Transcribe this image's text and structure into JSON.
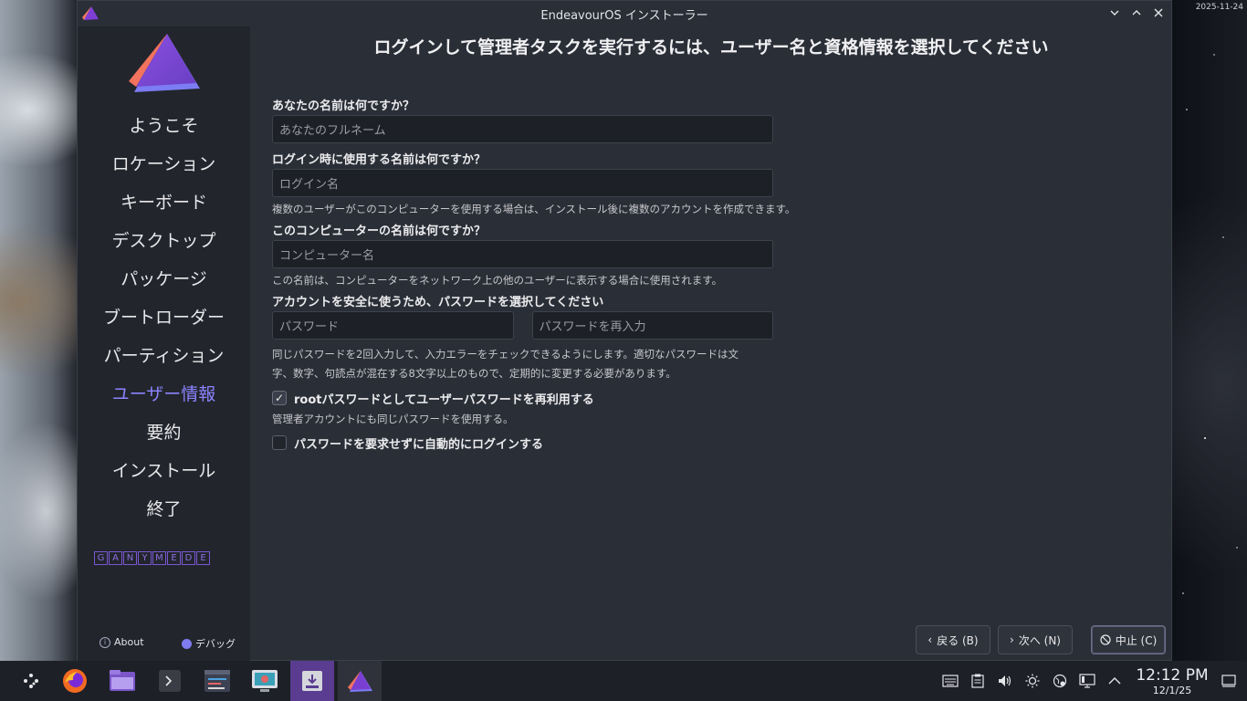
{
  "desktop": {
    "date_label": "2025-11-24"
  },
  "window": {
    "title": "EndeavourOS インストーラー",
    "controls": [
      "minimize",
      "maximize",
      "close"
    ]
  },
  "sidebar": {
    "items": [
      {
        "label": "ようこそ",
        "active": false
      },
      {
        "label": "ロケーション",
        "active": false
      },
      {
        "label": "キーボード",
        "active": false
      },
      {
        "label": "デスクトップ",
        "active": false
      },
      {
        "label": "パッケージ",
        "active": false
      },
      {
        "label": "ブートローダー",
        "active": false
      },
      {
        "label": "パーティション",
        "active": false
      },
      {
        "label": "ユーザー情報",
        "active": true
      },
      {
        "label": "要約",
        "active": false
      },
      {
        "label": "インストール",
        "active": false
      },
      {
        "label": "終了",
        "active": false
      }
    ],
    "brand_letters": [
      "G",
      "A",
      "N",
      "Y",
      "M",
      "E",
      "D",
      "E"
    ],
    "about_label": "About",
    "debug_label": "デバッグ"
  },
  "main": {
    "title": "ログインして管理者タスクを実行するには、ユーザー名と資格情報を選択してください",
    "fullname_question": "あなたの名前は何ですか？",
    "fullname_placeholder": "あなたのフルネーム",
    "login_question": "ログイン時に使用する名前は何ですか？",
    "login_placeholder": "ログイン名",
    "login_help": "複数のユーザーがこのコンピューターを使用する場合は、インストール後に複数のアカウントを作成できます。",
    "hostname_question": "このコンピューターの名前は何ですか？",
    "hostname_placeholder": "コンピューター名",
    "hostname_help": "この名前は、コンピューターをネットワーク上の他のユーザーに表示する場合に使用されます。",
    "password_question": "アカウントを安全に使うため、パスワードを選択してください",
    "password_placeholder": "パスワード",
    "password_repeat_placeholder": "パスワードを再入力",
    "password_help_line1": "同じパスワードを2回入力して、入力エラーをチェックできるようにします。適切なパスワードは文",
    "password_help_line2": "字、数字、句読点が混在する8文字以上のもので、定期的に変更する必要があります。",
    "reuse_root_label": "rootパスワードとしてユーザーパスワードを再利用する",
    "reuse_root_checked": true,
    "reuse_root_help": "管理者アカウントにも同じパスワードを使用する。",
    "autologin_label": "パスワードを要求せずに自動的にログインする",
    "autologin_checked": false
  },
  "buttons": {
    "back": "戻る (B)",
    "next": "次へ (N)",
    "cancel": "中止 (C)"
  },
  "taskbar": {
    "apps": [
      "app-launcher",
      "firefox",
      "file-manager",
      "terminal",
      "system-monitor",
      "screenshot-tool",
      "installer-download",
      "endeavouros-installer"
    ],
    "tray": [
      "keyboard-icon",
      "clipboard-icon",
      "volume-icon",
      "brightness-icon",
      "network-icon",
      "display-icon",
      "expand-tray-icon"
    ],
    "time": "12:12 PM",
    "date": "12/1/25"
  },
  "colors": {
    "accent": "#8c84ff",
    "window_bg": "#2a2e37",
    "sidebar_bg": "#22252c",
    "taskbar_active": "#5a3c90"
  }
}
